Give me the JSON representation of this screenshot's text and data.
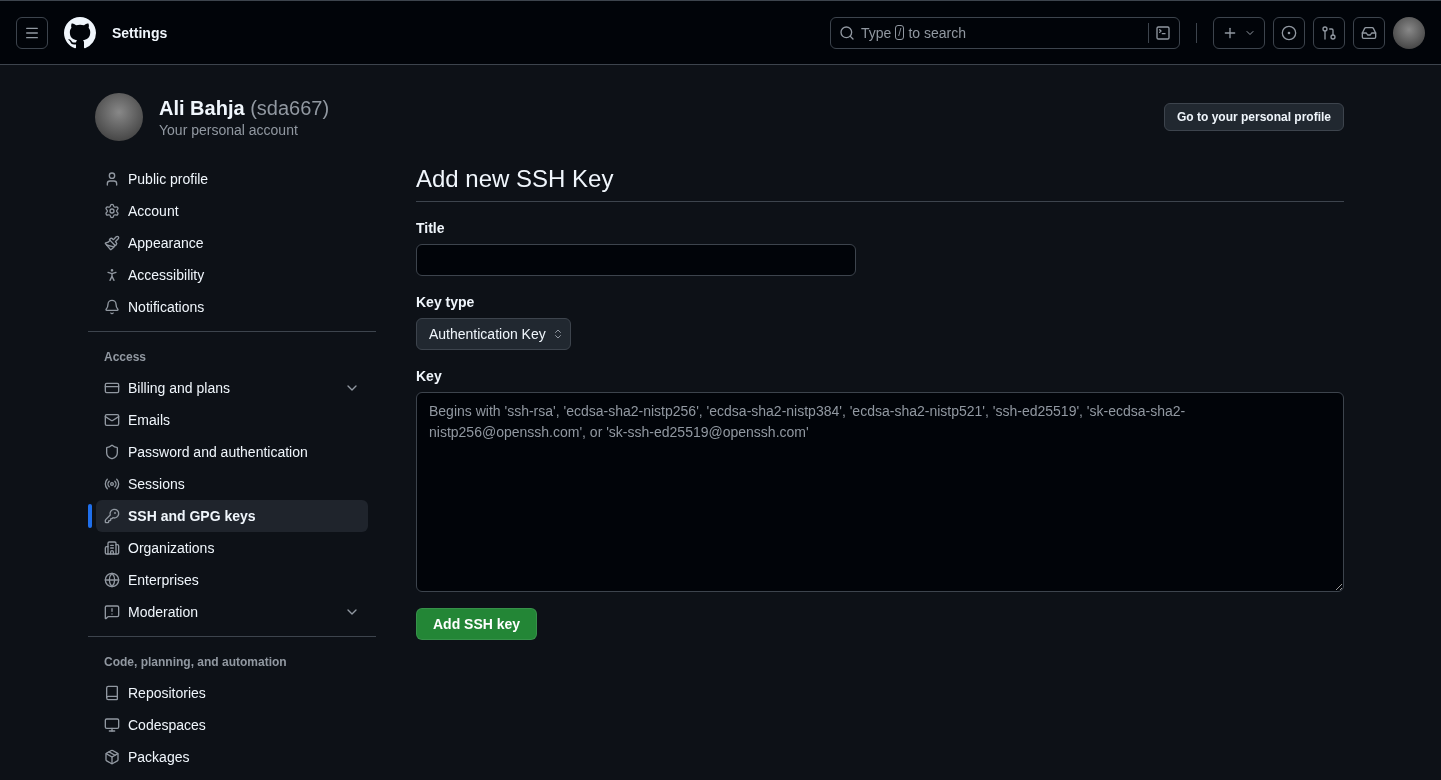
{
  "header": {
    "title": "Settings",
    "search": {
      "prefix": "Type",
      "key": "/",
      "suffix": "to search"
    }
  },
  "profile": {
    "name": "Ali Bahja",
    "handle": "(sda667)",
    "subtitle": "Your personal account",
    "profile_button": "Go to your personal profile"
  },
  "sidebar": {
    "groups": [
      {
        "items": [
          {
            "label": "Public profile",
            "selected": false
          },
          {
            "label": "Account",
            "selected": false
          },
          {
            "label": "Appearance",
            "selected": false
          },
          {
            "label": "Accessibility",
            "selected": false
          },
          {
            "label": "Notifications",
            "selected": false
          }
        ]
      },
      {
        "heading": "Access",
        "items": [
          {
            "label": "Billing and plans",
            "selected": false,
            "expanded": false
          },
          {
            "label": "Emails",
            "selected": false
          },
          {
            "label": "Password and authentication",
            "selected": false
          },
          {
            "label": "Sessions",
            "selected": false
          },
          {
            "label": "SSH and GPG keys",
            "selected": true
          },
          {
            "label": "Organizations",
            "selected": false
          },
          {
            "label": "Enterprises",
            "selected": false
          },
          {
            "label": "Moderation",
            "selected": false,
            "expanded": false
          }
        ]
      },
      {
        "heading": "Code, planning, and automation",
        "items": [
          {
            "label": "Repositories",
            "selected": false
          },
          {
            "label": "Codespaces",
            "selected": false
          },
          {
            "label": "Packages",
            "selected": false
          }
        ]
      }
    ]
  },
  "form": {
    "heading": "Add new SSH Key",
    "title_field": {
      "label": "Title"
    },
    "key_type": {
      "label": "Key type",
      "value": "Authentication Key"
    },
    "key_field": {
      "label": "Key",
      "placeholder": "Begins with 'ssh-rsa', 'ecdsa-sha2-nistp256', 'ecdsa-sha2-nistp384', 'ecdsa-sha2-nistp521', 'ssh-ed25519', 'sk-ecdsa-sha2-nistp256@openssh.com', or 'sk-ssh-ed25519@openssh.com'"
    },
    "submit": "Add SSH key"
  }
}
